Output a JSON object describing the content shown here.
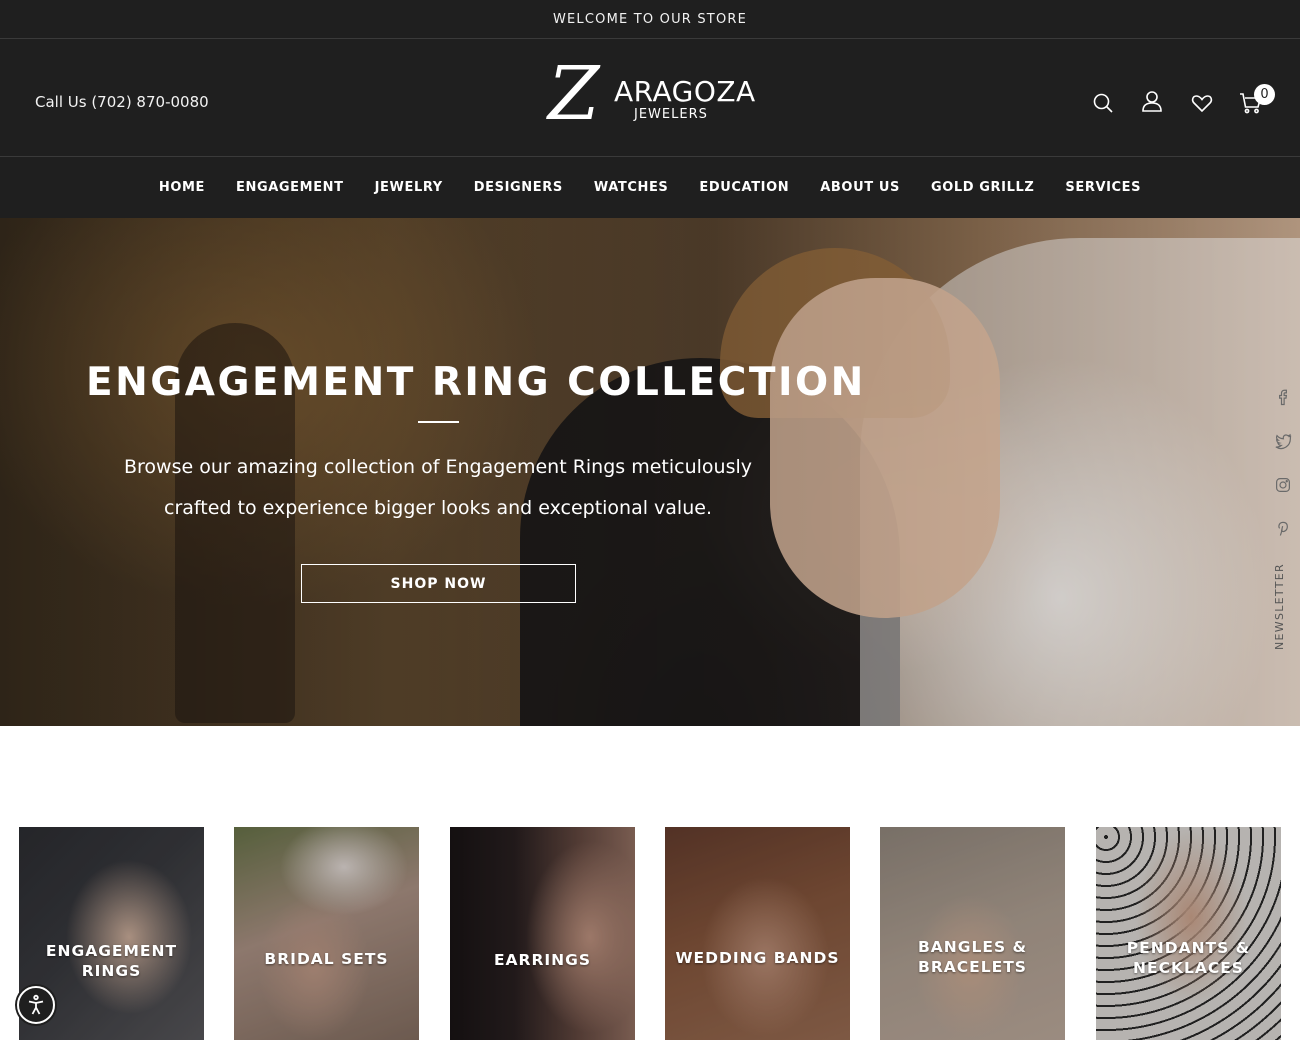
{
  "topbar": {
    "text": "WELCOME TO OUR STORE"
  },
  "header": {
    "phone": "Call Us (702) 870-0080",
    "logo": {
      "initial": "Z",
      "name": "ARAGOZA",
      "sub": "JEWELERS"
    },
    "icons": [
      "search-icon",
      "account-icon",
      "wishlist-heart-icon",
      "cart-icon"
    ],
    "cart_count": "0"
  },
  "nav": {
    "items": [
      "HOME",
      "ENGAGEMENT",
      "JEWELRY",
      "DESIGNERS",
      "WATCHES",
      "EDUCATION",
      "ABOUT US",
      "GOLD GRILLZ",
      "SERVICES"
    ]
  },
  "hero": {
    "title": "ENGAGEMENT RING COLLECTION",
    "text_line1": "Browse our amazing collection of Engagement Rings meticulously",
    "text_line2": "crafted to experience bigger looks and exceptional value.",
    "button": "SHOP NOW"
  },
  "social": {
    "icons": [
      "facebook-icon",
      "twitter-icon",
      "instagram-icon",
      "pinterest-icon"
    ],
    "newsletter": "NEWSLETTER"
  },
  "categories": [
    {
      "line1": "ENGAGEMENT",
      "line2": "RINGS"
    },
    {
      "line1": "BRIDAL SETS",
      "line2": ""
    },
    {
      "line1": "EARRINGS",
      "line2": ""
    },
    {
      "line1": "WEDDING BANDS",
      "line2": ""
    },
    {
      "line1": "BANGLES &",
      "line2": "BRACELETS"
    },
    {
      "line1": "PENDANTS &",
      "line2": "NECKLACES"
    }
  ],
  "colors": {
    "dark": "#1f1f1f",
    "white": "#ffffff",
    "social_gray": "#6a6a6a"
  }
}
